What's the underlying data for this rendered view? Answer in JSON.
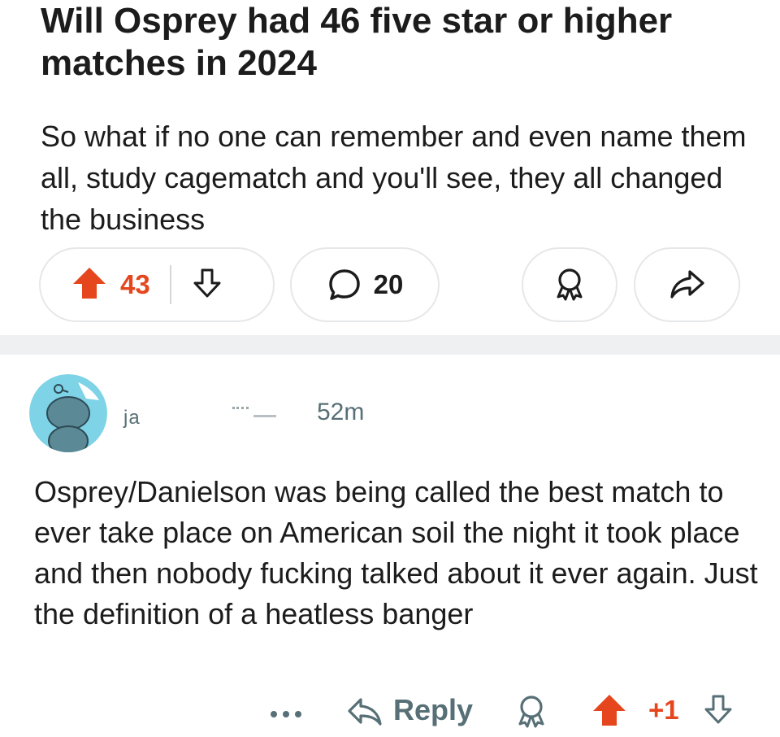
{
  "post": {
    "title": "Will Osprey had 46 five star or higher matches in 2024",
    "body": "So what if no one can remember and even name them all, study cagematch and you'll see, they all changed the business",
    "vote_count": "43",
    "comment_count": "20"
  },
  "comment": {
    "username": "ja",
    "time": "52m",
    "body": "Osprey/Danielson was being called the best match to ever take place on American soil the night it took place and then nobody fucking talked about it ever again. Just the definition of a heatless banger",
    "reply_label": "Reply",
    "score": "+1"
  },
  "colors": {
    "upvote": "#e5461d",
    "text_primary": "#1c1c1c",
    "text_secondary": "#576f76",
    "pill_border": "#e5e7e9",
    "separator": "#eef0f2",
    "avatar_bg": "#7ed3e6"
  },
  "icons": {
    "upvote": "up-arrow-icon",
    "downvote": "down-arrow-icon",
    "comments": "speech-bubble-icon",
    "award": "award-icon",
    "share": "share-arrow-icon",
    "more": "ellipsis-icon",
    "reply": "reply-arrow-icon",
    "avatar": "snoo-avatar-icon"
  }
}
